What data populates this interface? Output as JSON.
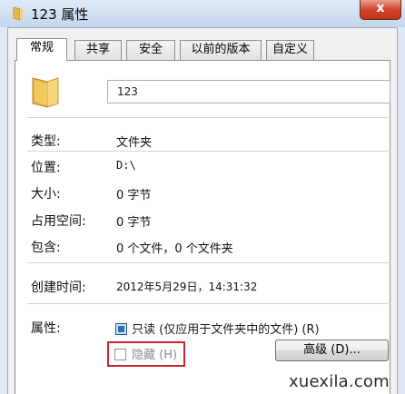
{
  "window": {
    "title": "123 属性",
    "close_label": "x"
  },
  "tabs": [
    {
      "label": "常规",
      "active": true
    },
    {
      "label": "共享",
      "active": false
    },
    {
      "label": "安全",
      "active": false
    },
    {
      "label": "以前的版本",
      "active": false
    },
    {
      "label": "自定义",
      "active": false
    }
  ],
  "general": {
    "folder_name": "123",
    "type_label": "类型:",
    "type_value": "文件夹",
    "location_label": "位置:",
    "location_value": "D:\\",
    "size_label": "大小:",
    "size_value": "0 字节",
    "size_on_disk_label": "占用空间:",
    "size_on_disk_value": "0 字节",
    "contains_label": "包含:",
    "contains_value": "0 个文件，0 个文件夹",
    "created_label": "创建时间:",
    "created_value": "2012年5月29日，14:31:32",
    "attributes_label": "属性:",
    "readonly_label": "只读 (仅应用于文件夹中的文件) (R)",
    "readonly_state": "checked",
    "hidden_label": "隐藏 (H)",
    "hidden_state": "unchecked",
    "advanced_button": "高级 (D)..."
  },
  "watermark": "xuexila.com",
  "colors": {
    "highlight_box": "#c9252c",
    "checkbox_checked": "#2f6fb8",
    "close_button": "#d2462f"
  }
}
